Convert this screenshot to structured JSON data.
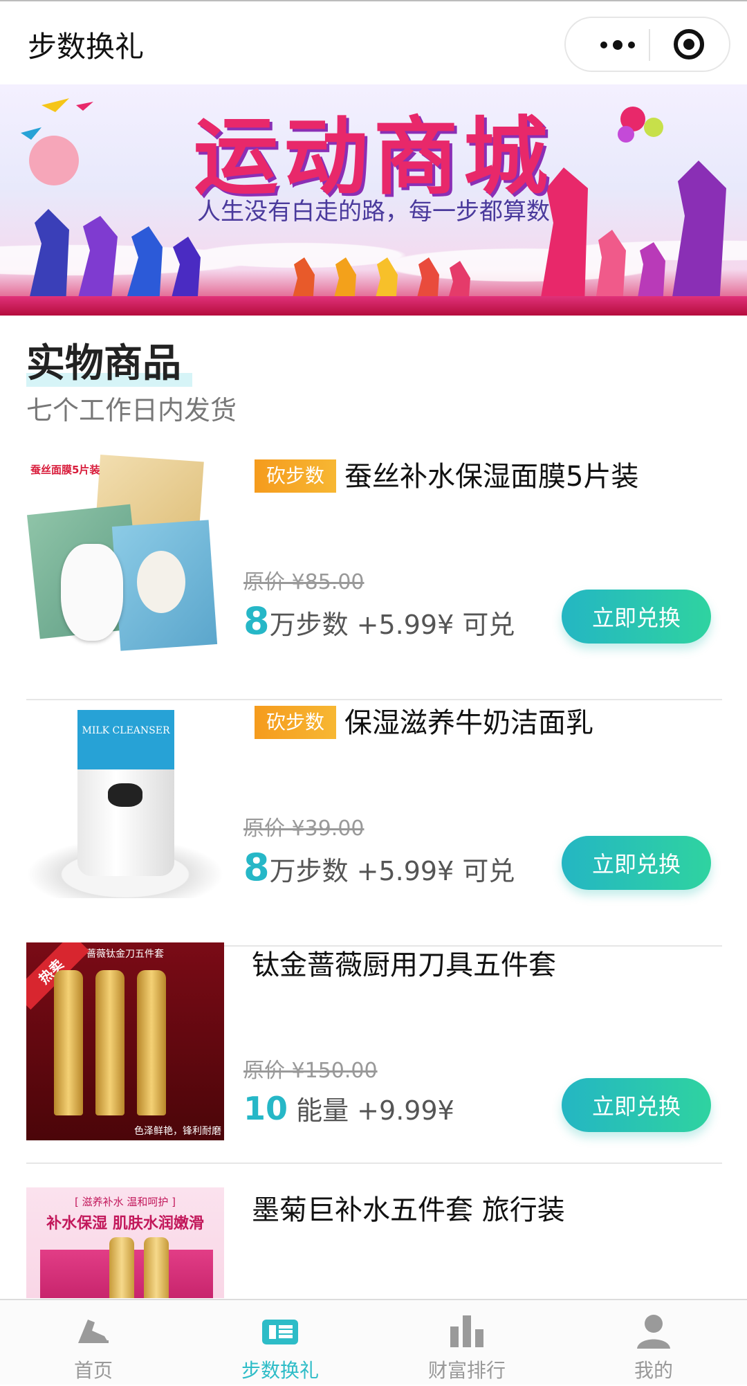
{
  "header": {
    "title": "步数换礼",
    "more_icon": "more-dots-icon",
    "close_icon": "target-icon"
  },
  "banner": {
    "title": "运动商城",
    "slogan": "人生没有白走的路，每一步都算数"
  },
  "section": {
    "title": "实物商品",
    "subtitle": "七个工作日内发货"
  },
  "products": [
    {
      "tag": "砍步数",
      "name": "蚕丝补水保湿面膜5片装",
      "original_price": "原价 ¥85.00",
      "price_num": "8",
      "price_rest": "万步数 +5.99¥ 可兑",
      "button": "立即兑换",
      "thumb_label": "蚕丝面膜5片装"
    },
    {
      "tag": "砍步数",
      "name": "保湿滋养牛奶洁面乳",
      "original_price": "原价 ¥39.00",
      "price_num": "8",
      "price_rest": "万步数 +5.99¥ 可兑",
      "button": "立即兑换",
      "thumb_label": "MILK CLEANSER"
    },
    {
      "name": "钛金蔷薇厨用刀具五件套",
      "original_price": "原价 ¥150.00",
      "price_num": "10",
      "price_rest": " 能量 +9.99¥",
      "button": "立即兑换",
      "thumb_label": "蔷薇钛金刀五件套",
      "thumb_badge": "热卖",
      "thumb_caption": "色泽鲜艳，锋利耐磨"
    },
    {
      "name": "墨菊巨补水五件套 旅行装",
      "thumb_label": "[ 滋养补水 温和呵护 ]",
      "thumb_label2": "补水保湿 肌肤水润嫩滑"
    }
  ],
  "tabbar": {
    "active_color": "#2dbcc7",
    "items": [
      {
        "label": "首页",
        "icon": "sneaker-icon"
      },
      {
        "label": "步数换礼",
        "icon": "exchange-icon"
      },
      {
        "label": "财富排行",
        "icon": "bar-chart-icon"
      },
      {
        "label": "我的",
        "icon": "user-icon"
      }
    ]
  }
}
